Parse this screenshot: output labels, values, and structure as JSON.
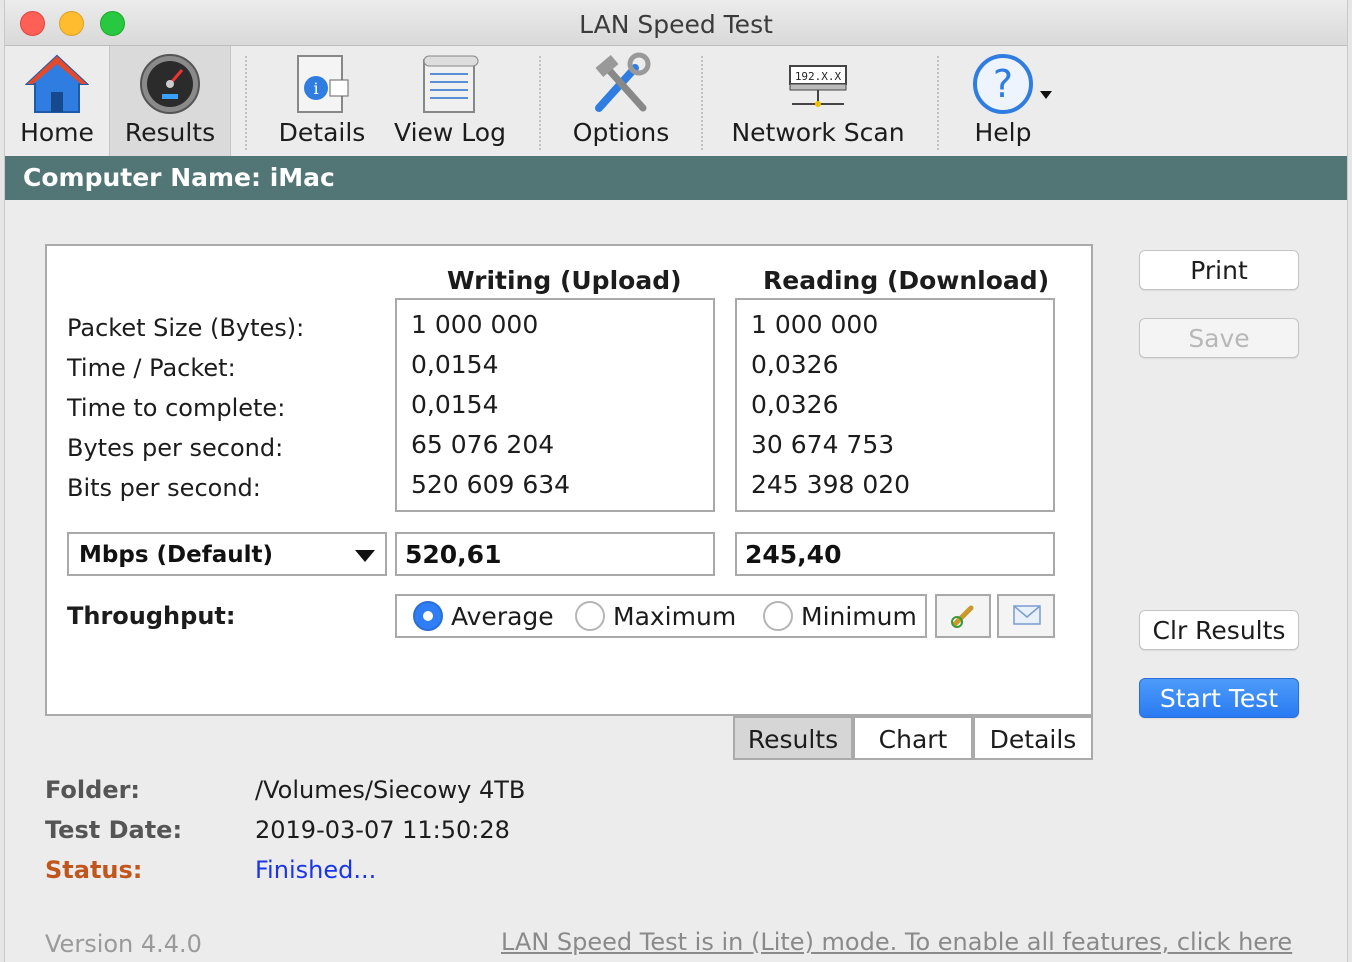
{
  "window": {
    "title": "LAN Speed Test"
  },
  "toolbar": {
    "home": "Home",
    "results": "Results",
    "details": "Details",
    "view_log": "View Log",
    "options": "Options",
    "network_scan": "Network Scan",
    "network_scan_icon_text": "192.X.X",
    "help": "Help"
  },
  "computer_name": "Computer Name: iMac",
  "results": {
    "col_upload": "Writing (Upload)",
    "col_download": "Reading (Download)",
    "row_labels": [
      "Packet Size (Bytes):",
      "Time / Packet:",
      "Time to complete:",
      "Bytes per second:",
      "Bits per second:"
    ],
    "upload_values": [
      "1 000 000",
      "0,0154",
      "0,0154",
      "65 076 204",
      "520 609 634"
    ],
    "download_values": [
      "1 000 000",
      "0,0326",
      "0,0326",
      "30 674 753",
      "245 398 020"
    ],
    "unit_selected": "Mbps (Default)",
    "upload_mbps": "520,61",
    "download_mbps": "245,40",
    "throughput_label": "Throughput:",
    "throughput_options": [
      "Average",
      "Maximum",
      "Minimum"
    ],
    "throughput_selected": "Average"
  },
  "tabs": [
    "Results",
    "Chart",
    "Details"
  ],
  "buttons": {
    "print": "Print",
    "save": "Save",
    "clr_results": "Clr Results",
    "start_test": "Start Test"
  },
  "info": {
    "folder_label": "Folder:",
    "folder_value": "/Volumes/Siecowy 4TB",
    "date_label": "Test Date:",
    "date_value": "2019-03-07 11:50:28",
    "status_label": "Status:",
    "status_value": "Finished..."
  },
  "footer": {
    "version": "Version 4.4.0",
    "lite_notice": "LAN Speed Test is in (Lite) mode.  To enable all features, click here"
  },
  "colors": {
    "header_bar": "#527576",
    "status_label": "#c1561d",
    "status_value": "#1a35e8",
    "primary_button": "#2a7bf3"
  }
}
